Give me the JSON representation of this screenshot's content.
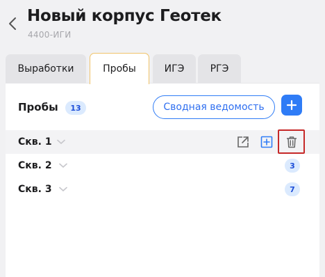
{
  "header": {
    "title": "Новый корпус Геотек",
    "subtitle": "4400-ИГИ"
  },
  "tabs": [
    {
      "label": "Выработки",
      "active": false
    },
    {
      "label": "Пробы",
      "active": true
    },
    {
      "label": "ИГЭ",
      "active": false
    },
    {
      "label": "РГЭ",
      "active": false
    }
  ],
  "panel": {
    "title": "Пробы",
    "count": "13",
    "summary_button": "Сводная ведомость"
  },
  "rows": [
    {
      "label": "Скв. 1",
      "count": null
    },
    {
      "label": "Скв. 2",
      "count": "3"
    },
    {
      "label": "Скв. 3",
      "count": "7"
    }
  ],
  "colors": {
    "accent": "#2f7cf6",
    "badge_bg": "#dbeafe",
    "active_tab_border": "#f0c36a",
    "delete_highlight": "#c62828"
  }
}
